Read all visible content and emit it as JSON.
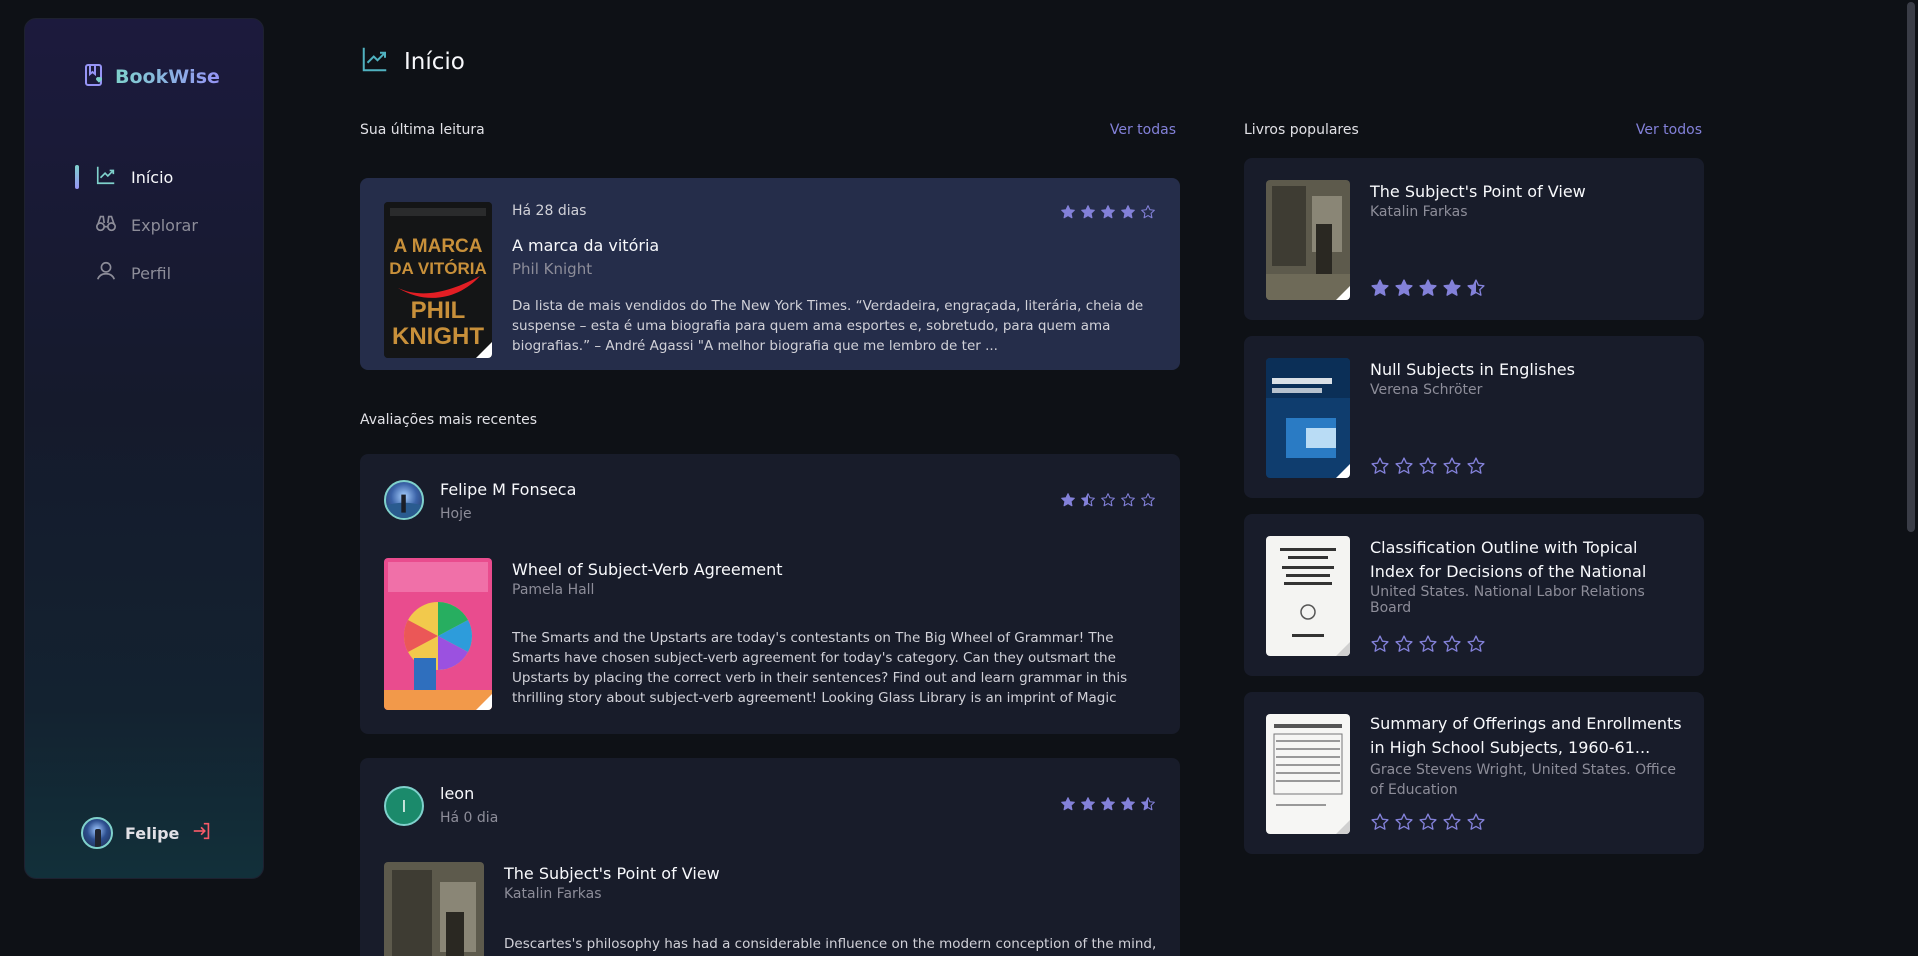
{
  "app": {
    "name": "BookWise"
  },
  "sidebar": {
    "items": [
      {
        "label": "Início",
        "icon": "chart-line-icon",
        "active": true
      },
      {
        "label": "Explorar",
        "icon": "binoculars-icon",
        "active": false
      },
      {
        "label": "Perfil",
        "icon": "user-icon",
        "active": false
      }
    ],
    "user": {
      "name": "Felipe"
    }
  },
  "page": {
    "title": "Início"
  },
  "last_reading": {
    "section_label": "Sua última leitura",
    "link": "Ver todas",
    "time": "Há 28 dias",
    "rating": 4,
    "title": "A marca da vitória",
    "author": "Phil Knight",
    "description": "Da lista de mais vendidos do The New York Times. “Verdadeira, engraçada, literária, cheia de suspense – esta é uma biografia para quem ama esportes e, sobretudo, para quem ama biografias.” – André Agassi \"A melhor biografia que me lembro de ter ...",
    "cover_text": [
      "A MARCA",
      "DA VITÓRIA",
      "PHIL",
      "KNIGHT"
    ]
  },
  "recent_reviews": {
    "section_label": "Avaliações mais recentes",
    "items": [
      {
        "user": "Felipe M Fonseca",
        "time": "Hoje",
        "rating": 1.5,
        "title": "Wheel of Subject-Verb Agreement",
        "author": "Pamela Hall",
        "description": "The Smarts and the Upstarts are today's contestants on The Big Wheel of Grammar! The Smarts have chosen subject-verb agreement for today's category. Can they outsmart the Upstarts by placing the correct verb in their sentences? Find out and learn grammar in this thrilling story about subject-verb agreement! Looking Glass Library is an imprint of Magic Wagon, a division of ABDO Group. Grades P..."
      },
      {
        "user": "leon",
        "avatar_letter": "l",
        "time": "Há 0 dia",
        "rating": 4.5,
        "title": "The Subject's Point of View",
        "author": "Katalin Farkas",
        "description": "Descartes's philosophy has had a considerable influence on the modern conception of the mind, but"
      }
    ]
  },
  "popular": {
    "section_label": "Livros populares",
    "link": "Ver todos",
    "items": [
      {
        "title": "The Subject's Point of View",
        "author": "Katalin Farkas",
        "rating": 4.5
      },
      {
        "title": "Null Subjects in Englishes",
        "author": "Verena Schröter",
        "rating": 0
      },
      {
        "title": "Classification Outline with Topical Index for Decisions of the National Labor Relations...",
        "author": "United States. National Labor Relations Board",
        "rating": 0
      },
      {
        "title": "Summary of Offerings and Enrollments in High School Subjects, 1960-61...",
        "author": "Grace Stevens Wright, United States. Office of Education",
        "rating": 0
      }
    ]
  },
  "colors": {
    "accent": "#8381d9",
    "star": "#8381d9",
    "card": "#181c2a",
    "highlight_card": "#252d4a"
  }
}
